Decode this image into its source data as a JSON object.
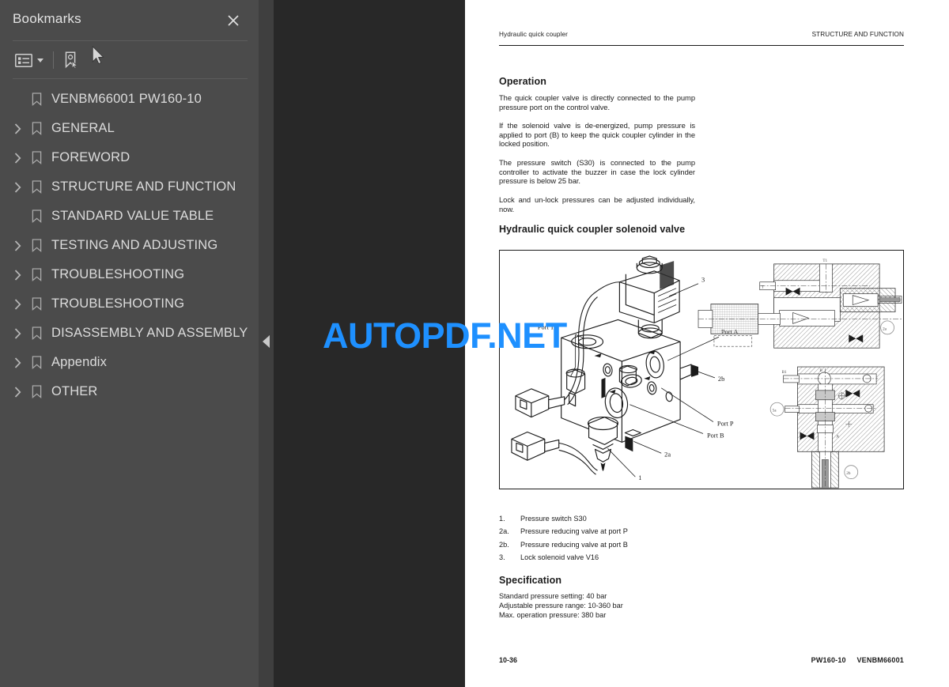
{
  "sidebar": {
    "title": "Bookmarks",
    "close_icon": "close-icon",
    "toolbar": {
      "options_icon": "list-options-icon",
      "expand_icon": "bookmark-pointer-icon"
    },
    "cursor_icon": "mouse-cursor",
    "items": [
      {
        "label": "VENBM66001 PW160-10",
        "expandable": false
      },
      {
        "label": "GENERAL",
        "expandable": true
      },
      {
        "label": "FOREWORD",
        "expandable": true
      },
      {
        "label": "STRUCTURE AND FUNCTION",
        "expandable": true
      },
      {
        "label": "STANDARD VALUE TABLE",
        "expandable": false
      },
      {
        "label": "TESTING AND ADJUSTING",
        "expandable": true
      },
      {
        "label": "TROUBLESHOOTING",
        "expandable": true
      },
      {
        "label": "TROUBLESHOOTING",
        "expandable": true
      },
      {
        "label": "DISASSEMBLY AND ASSEMBLY",
        "expandable": true
      },
      {
        "label": "Appendix",
        "expandable": true
      },
      {
        "label": "OTHER",
        "expandable": true
      }
    ]
  },
  "viewer": {
    "collapse_handle_icon": "collapse-left-icon",
    "watermark": "AUTOPDF.NET",
    "watermark_color": "#1e90ff",
    "background_color": "#282828",
    "sidebar_color": "#4b4b4b"
  },
  "page": {
    "header_left": "Hydraulic quick coupler",
    "header_right": "STRUCTURE AND FUNCTION",
    "heading_operation": "Operation",
    "paragraphs": [
      "The quick coupler valve is directly connected to the pump pressure port on the control valve.",
      "If the solenoid valve is de-energized, pump pressure is applied to port (B) to keep the quick coupler cylinder in the locked position.",
      "The pressure switch (S30) is connected to the pump controller to activate the buzzer in case the lock cylinder pressure is below 25 bar.",
      "Lock and un-lock pressures can be adjusted individually, now."
    ],
    "heading_valve": "Hydraulic quick coupler solenoid valve",
    "figure": {
      "callouts": [
        "Port T",
        "Port A",
        "Port P",
        "Port B",
        "1",
        "2a",
        "2b",
        "3"
      ],
      "section_labels": [
        "T",
        "T1",
        "2a",
        "B",
        "B1",
        "5a",
        "2b"
      ]
    },
    "legend": [
      {
        "num": "1.",
        "text": "Pressure switch S30"
      },
      {
        "num": "2a.",
        "text": "Pressure reducing valve at port P"
      },
      {
        "num": "2b.",
        "text": "Pressure reducing valve at port B"
      },
      {
        "num": "3.",
        "text": "Lock solenoid valve V16"
      }
    ],
    "heading_spec": "Specification",
    "spec_lines": [
      "Standard pressure setting: 40 bar",
      "Adjustable pressure range: 10-360 bar",
      "Max. operation pressure: 380 bar"
    ],
    "footer_left": "10-36",
    "footer_right_model": "PW160-10",
    "footer_right_code": "VENBM66001"
  }
}
